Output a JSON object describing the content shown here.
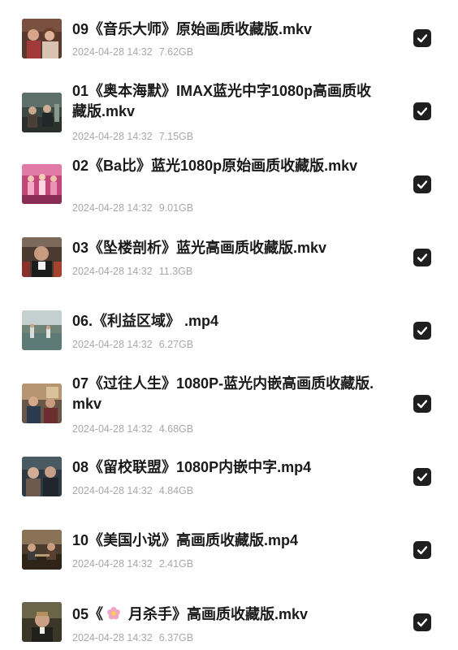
{
  "files": [
    {
      "name": "09《音乐大师》原始画质收藏版.mkv",
      "date": "2024-04-28 14:32",
      "size": "7.62GB",
      "checked": true
    },
    {
      "name": "01《奥本海默》IMAX蓝光中字1080p高画质收藏版.mkv",
      "date": "2024-04-28 14:32",
      "size": "7.15GB",
      "checked": true
    },
    {
      "name": "02《Ba比》蓝光1080p原始画质收藏版.mkv",
      "date": "2024-04-28 14:32",
      "size": "9.01GB",
      "checked": true
    },
    {
      "name": "03《坠楼剖析》蓝光高画质收藏版.mkv",
      "date": "2024-04-28 14:32",
      "size": "11.3GB",
      "checked": true
    },
    {
      "name": "06.《利益区域》 .mp4",
      "date": "2024-04-28 14:32",
      "size": "6.27GB",
      "checked": true
    },
    {
      "name": "07《过往人生》1080P-蓝光内嵌高画质收藏版.mkv",
      "date": "2024-04-28 14:32",
      "size": "4.68GB",
      "checked": true
    },
    {
      "name": "08《留校联盟》1080P内嵌中字.mp4",
      "date": "2024-04-28 14:32",
      "size": "4.84GB",
      "checked": true
    },
    {
      "name": "10《美国小说》高画质收藏版.mp4",
      "date": "2024-04-28 14:32",
      "size": "2.41GB",
      "checked": true
    },
    {
      "name_prefix": "05《",
      "name_icon": "flower-emoji-icon",
      "name_suffix": " 月杀手》高画质收藏版.mkv",
      "date": "2024-04-28 14:32",
      "size": "6.37GB",
      "checked": true
    }
  ],
  "colors": {
    "title": "#1a1a1a",
    "meta": "#a8a8a8",
    "checkbox": "#1f1f1f",
    "check": "#ffffff",
    "background": "#ffffff"
  }
}
